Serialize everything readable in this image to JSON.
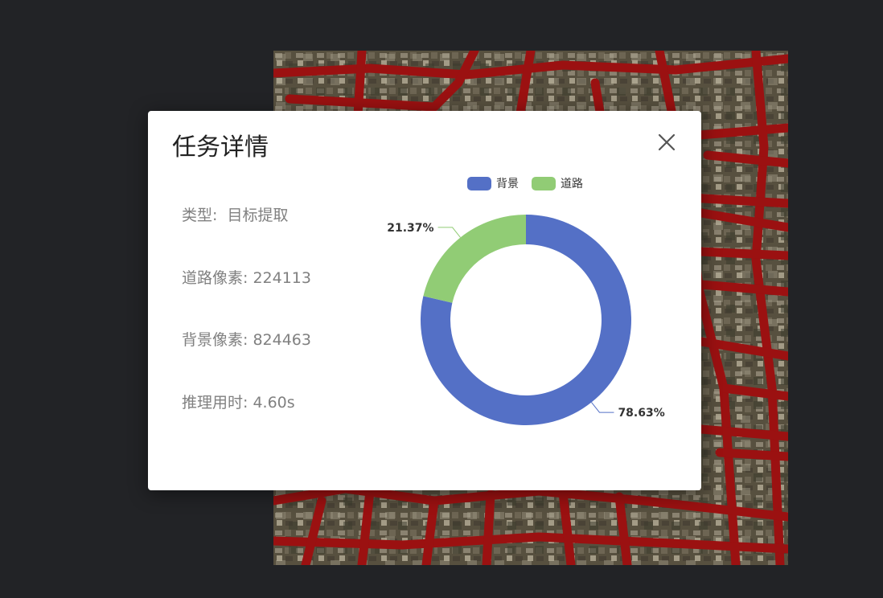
{
  "modal": {
    "title": "任务详情",
    "close_icon": "close-icon"
  },
  "info": {
    "type_label": "类型:",
    "type_value": "目标提取",
    "road_pixels_label": "道路像素:",
    "road_pixels_value": "224113",
    "background_pixels_label": "背景像素:",
    "background_pixels_value": "824463",
    "inference_time_label": "推理用时:",
    "inference_time_value": "4.60s"
  },
  "colors": {
    "page_background": "#222326",
    "road_overlay": "#9b1111",
    "background_series": "#5470c6",
    "road_series": "#91cc75"
  },
  "chart_data": {
    "type": "pie",
    "variant": "donut",
    "legend_position": "top-center",
    "series": [
      {
        "name": "背景",
        "value": 824463,
        "label": "78.63%",
        "color": "#5470c6"
      },
      {
        "name": "道路",
        "value": 224113,
        "label": "21.37%",
        "color": "#91cc75"
      }
    ]
  }
}
